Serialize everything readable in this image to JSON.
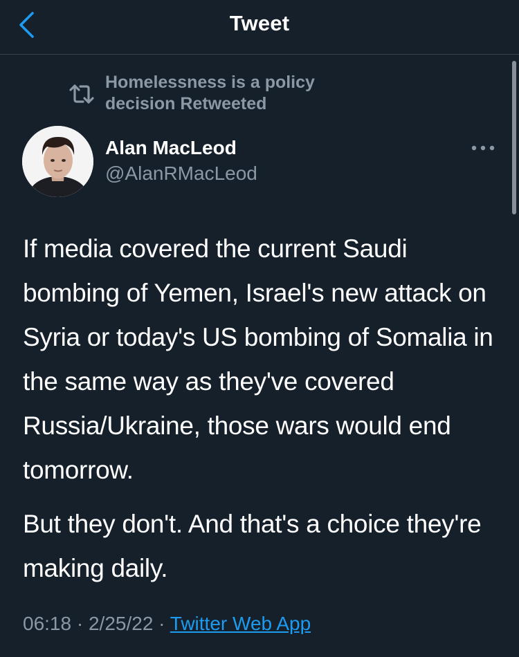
{
  "header": {
    "title": "Tweet",
    "back_icon": "chevron-left-icon",
    "accent_color": "#1d9bf0"
  },
  "retweet": {
    "icon": "retweet-icon",
    "text": "Homelessness is a policy decision Retweeted"
  },
  "author": {
    "name": "Alan MacLeod",
    "handle": "@AlanRMacLeod",
    "avatar": "avatar-photo"
  },
  "more_icon": "more-horizontal-icon",
  "tweet": {
    "paragraphs": [
      "If media covered the current Saudi bombing of Yemen, Israel's new attack on Syria or today's US bombing of Somalia in the same way as they've covered Russia/Ukraine, those wars would end tomorrow.",
      "But they don't. And that's a choice they're making daily."
    ]
  },
  "meta": {
    "time": "06:18",
    "date": "2/25/22",
    "separator": "·",
    "source": "Twitter Web App"
  },
  "colors": {
    "background": "#15202b",
    "secondary_text": "#8b98a5",
    "link": "#1d9bf0",
    "divider": "#38444d"
  }
}
